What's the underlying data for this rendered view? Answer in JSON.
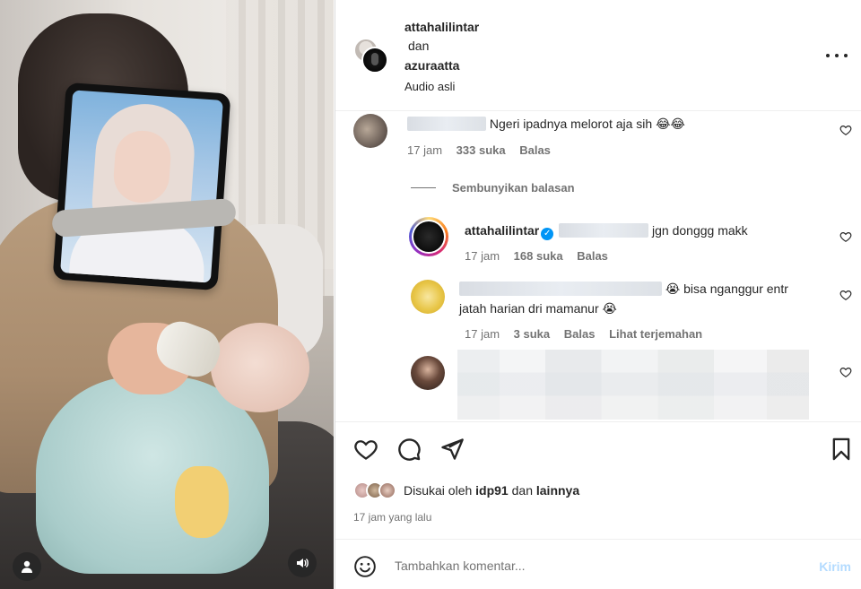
{
  "post": {
    "author1": "attahalilintar",
    "conjunction": "dan",
    "author2": "azuraatta",
    "audio": "Audio asli"
  },
  "comments": [
    {
      "text": "Ngeri ipadnya melorot aja sih 😂😂",
      "time": "17 jam",
      "likes": "333 suka",
      "reply": "Balas"
    }
  ],
  "hide_replies": "Sembunyikan balasan",
  "replies": [
    {
      "username": "attahalilintar",
      "text": "jgn donggg makk",
      "time": "17 jam",
      "likes": "168 suka",
      "reply": "Balas"
    },
    {
      "text_line1": "😭 bisa nganggur entr",
      "text_line2": "jatah harian dri mamanur 😭",
      "time": "17 jam",
      "likes": "3 suka",
      "reply": "Balas",
      "translate": "Lihat terjemahan"
    }
  ],
  "likes": {
    "prefix": "Disukai oleh",
    "user": "idp91",
    "and": "dan",
    "others": "lainnya"
  },
  "time_ago": "17 jam yang lalu",
  "composer": {
    "placeholder": "Tambahkan komentar...",
    "post_label": "Kirim"
  },
  "icons": {
    "comment_like": "heart-outline-icon",
    "like": "heart-icon",
    "comment": "comment-bubble-icon",
    "share": "paper-plane-icon",
    "save": "bookmark-icon",
    "emoji": "smiley-icon",
    "more": "more-horizontal-icon",
    "user_tag": "user-icon",
    "audio": "speaker-icon"
  },
  "colors": {
    "text": "#262626",
    "secondary": "#737373",
    "link_disabled": "#b3dbff",
    "verified": "#0095f6"
  }
}
